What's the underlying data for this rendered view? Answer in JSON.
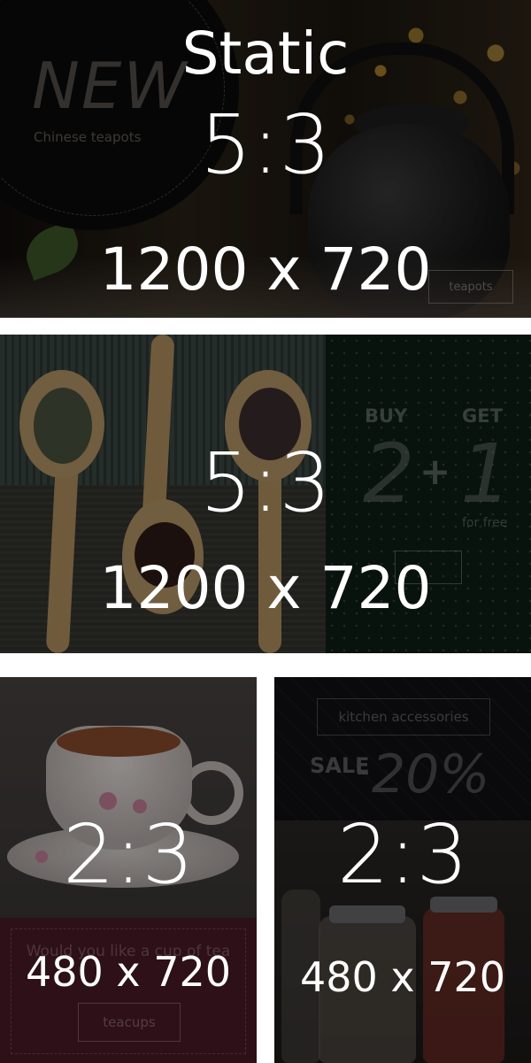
{
  "banners": [
    {
      "overlay": {
        "mode": "Static",
        "ratio": "5:3",
        "size": "1200 x 720"
      },
      "underlay": {
        "headline": "NEW",
        "subtitle": "Chinese teapots",
        "button_label": "teapots"
      }
    },
    {
      "overlay": {
        "ratio": "5:3",
        "size": "1200 x 720"
      },
      "underlay": {
        "buy": "BUY",
        "get": "GET",
        "buy_qty": "2",
        "plus": "+",
        "get_qty": "1",
        "free": "for free",
        "button_label": ""
      }
    },
    {
      "overlay": {
        "ratio": "2:3",
        "size": "480 x 720"
      },
      "underlay": {
        "text": "Would you like a cup of tea",
        "button_label": "teacups"
      }
    },
    {
      "overlay": {
        "ratio": "2:3",
        "size": "480 x 720"
      },
      "underlay": {
        "category": "kitchen accessories",
        "sale": "SALE",
        "discount": "20%"
      }
    }
  ],
  "colors": {
    "overlay_text": "#ffffff",
    "banner3_panel": "#4a1a27",
    "banner2_panel": "#0e1f17"
  }
}
